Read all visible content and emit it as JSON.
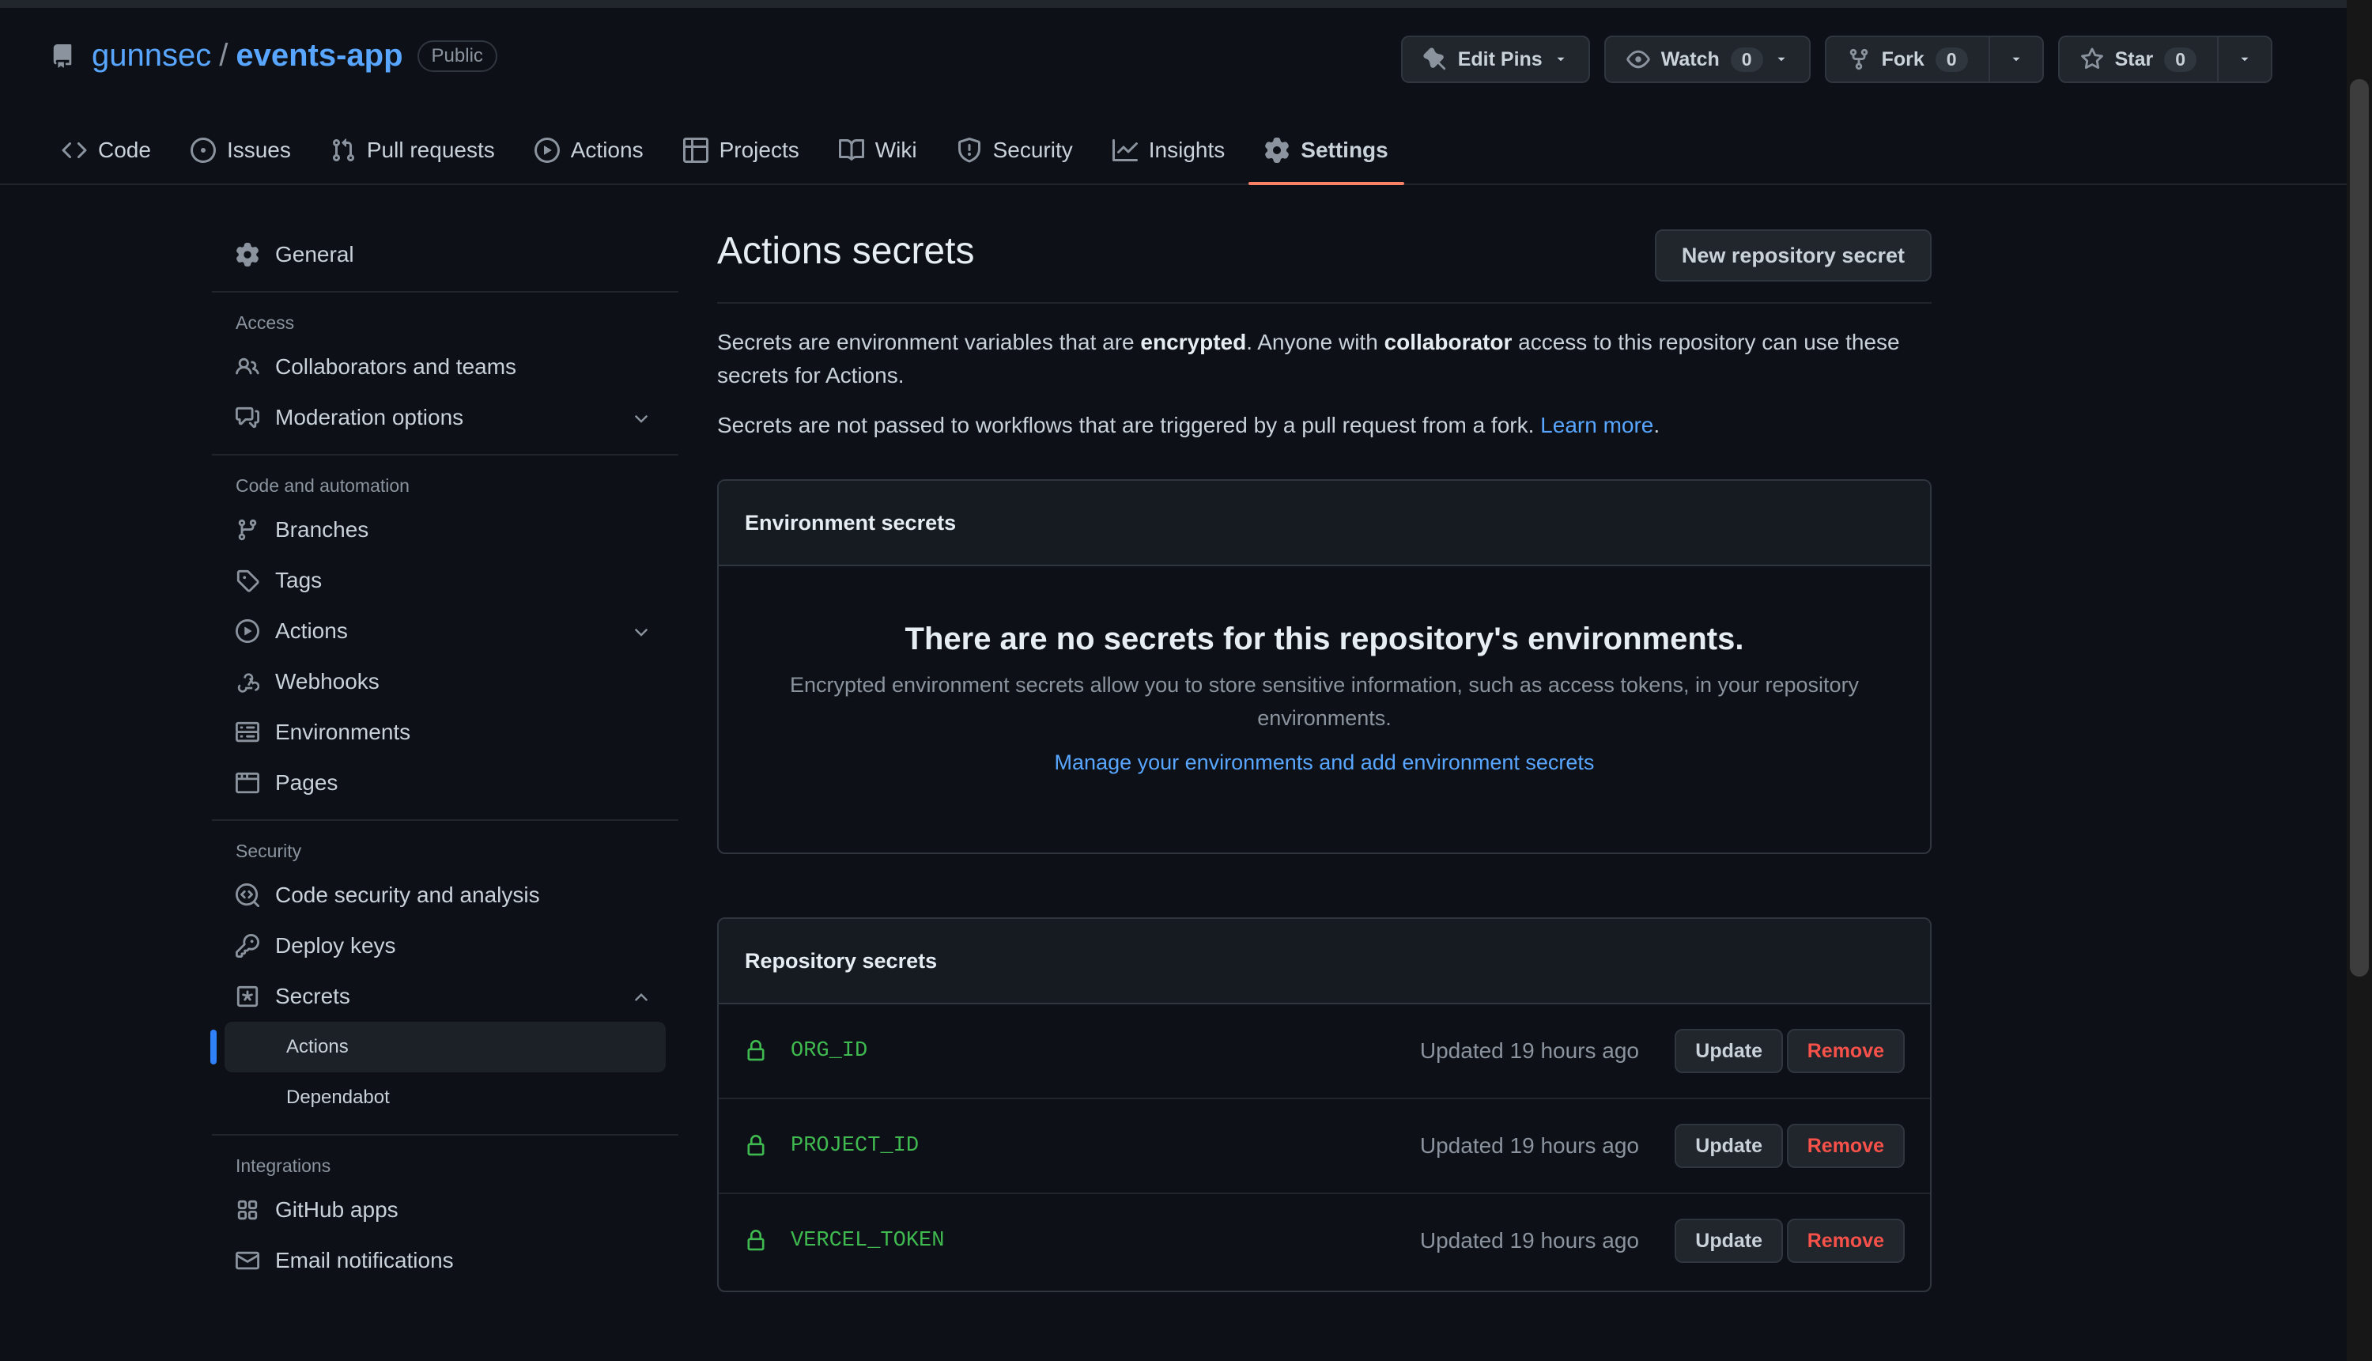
{
  "repo": {
    "owner": "gunnsec",
    "separator": "/",
    "name": "events-app",
    "visibility": "Public"
  },
  "actions": {
    "edit_pins": "Edit Pins",
    "watch": "Watch",
    "watch_count": "0",
    "fork": "Fork",
    "fork_count": "0",
    "star": "Star",
    "star_count": "0"
  },
  "nav": {
    "tabs": [
      {
        "label": "Code",
        "icon": "code-icon"
      },
      {
        "label": "Issues",
        "icon": "issue-icon"
      },
      {
        "label": "Pull requests",
        "icon": "pull-request-icon"
      },
      {
        "label": "Actions",
        "icon": "play-icon"
      },
      {
        "label": "Projects",
        "icon": "table-icon"
      },
      {
        "label": "Wiki",
        "icon": "book-icon"
      },
      {
        "label": "Security",
        "icon": "shield-icon"
      },
      {
        "label": "Insights",
        "icon": "graph-icon"
      },
      {
        "label": "Settings",
        "icon": "gear-icon",
        "active": true
      }
    ]
  },
  "sidebar": {
    "general": "General",
    "access_heading": "Access",
    "collaborators": "Collaborators and teams",
    "moderation": "Moderation options",
    "code_heading": "Code and automation",
    "branches": "Branches",
    "tags": "Tags",
    "actions": "Actions",
    "webhooks": "Webhooks",
    "environments": "Environments",
    "pages": "Pages",
    "security_heading": "Security",
    "code_security": "Code security and analysis",
    "deploy_keys": "Deploy keys",
    "secrets": "Secrets",
    "secrets_actions": "Actions",
    "secrets_dependabot": "Dependabot",
    "integrations_heading": "Integrations",
    "github_apps": "GitHub apps",
    "email_notifications": "Email notifications"
  },
  "main": {
    "title": "Actions secrets",
    "new_secret_button": "New repository secret",
    "desc1_a": "Secrets are environment variables that are ",
    "desc1_b": "encrypted",
    "desc1_c": ". Anyone with ",
    "desc1_d": "collaborator",
    "desc1_e": " access to this repository can use these secrets for Actions.",
    "desc2_a": "Secrets are not passed to workflows that are triggered by a pull request from a fork. ",
    "desc2_link": "Learn more",
    "desc2_b": ".",
    "env_header": "Environment secrets",
    "env_blank_title": "There are no secrets for this repository's environments.",
    "env_blank_text": "Encrypted environment secrets allow you to store sensitive information, such as access tokens, in your repository environments.",
    "env_blank_link": "Manage your environments and add environment secrets",
    "repo_header": "Repository secrets",
    "secrets": [
      {
        "name": "ORG_ID",
        "updated": "Updated 19 hours ago",
        "update": "Update",
        "remove": "Remove"
      },
      {
        "name": "PROJECT_ID",
        "updated": "Updated 19 hours ago",
        "update": "Update",
        "remove": "Remove"
      },
      {
        "name": "VERCEL_TOKEN",
        "updated": "Updated 19 hours ago",
        "update": "Update",
        "remove": "Remove"
      }
    ]
  },
  "colors": {
    "background": "#0d1117",
    "link": "#58a6ff",
    "active_tab_underline": "#f78166",
    "secret_name": "#3fb950",
    "remove_text": "#f85149"
  }
}
